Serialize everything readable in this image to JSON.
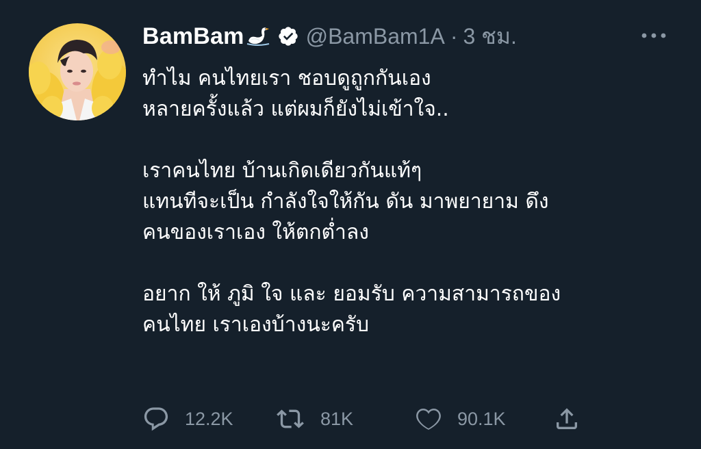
{
  "author": {
    "display_name": "BamBam",
    "name_emoji": "swan-icon",
    "verified": true,
    "handle": "@BamBam1A",
    "separator": "·",
    "timestamp": "3 ชม."
  },
  "tweet": {
    "lines": [
      "ทำไม คนไทยเรา ชอบดูถูกกันเอง",
      "หลายครั้งแล้ว แต่ผมก็ยังไม่เข้าใจ..",
      "",
      "เราคนไทย บ้านเกิดเดียวกันแท้ๆ",
      "แทนทีจะเป็น กำลังใจให้กัน ดัน มาพยายาม ดึง",
      "คนของเราเอง  ให้ตกต่ำลง",
      "",
      "อยาก ให้ ภูมิ ใจ และ ยอมรับ  ความสามารถของ",
      "คนไทย เราเองบ้างนะครับ"
    ]
  },
  "actions": {
    "reply_count": "12.2K",
    "retweet_count": "81K",
    "like_count": "90.1K"
  },
  "icons": {
    "reply": "reply-icon",
    "retweet": "retweet-icon",
    "like": "heart-icon",
    "share": "share-icon",
    "more": "more-dots-icon",
    "verified": "verified-badge-icon"
  },
  "colors": {
    "background": "#15202b",
    "text": "#ffffff",
    "secondary": "#8b98a5"
  }
}
